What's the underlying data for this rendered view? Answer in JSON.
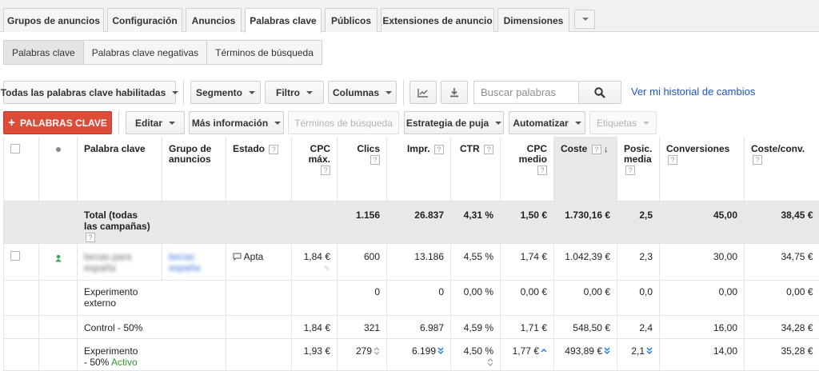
{
  "tabs": [
    {
      "label": "Grupos de anuncios",
      "active": false
    },
    {
      "label": "Configuración",
      "active": false
    },
    {
      "label": "Anuncios",
      "active": false
    },
    {
      "label": "Palabras clave",
      "active": true
    },
    {
      "label": "Públicos",
      "active": false
    },
    {
      "label": "Extensiones de anuncio",
      "active": false
    },
    {
      "label": "Dimensiones",
      "active": false
    }
  ],
  "subtabs": [
    {
      "label": "Palabras clave",
      "active": true
    },
    {
      "label": "Palabras clave negativas",
      "active": false
    },
    {
      "label": "Términos de búsqueda",
      "active": false
    }
  ],
  "toolbar": {
    "filter_all": "Todas las palabras clave habilitadas",
    "segment": "Segmento",
    "filter": "Filtro",
    "columns": "Columnas",
    "search_placeholder": "Buscar palabras",
    "history_link": "Ver mi historial de cambios"
  },
  "actions": {
    "add_keywords": "PALABRAS CLAVE",
    "edit": "Editar",
    "more_info": "Más información",
    "search_terms": "Términos de búsqueda",
    "bid_strategy": "Estrategia de puja",
    "automate": "Automatizar",
    "labels": "Etiquetas"
  },
  "table": {
    "headers": {
      "keyword": "Palabra clave",
      "ad_group": "Grupo de anuncios",
      "status": "Estado",
      "max_cpc": "CPC máx.",
      "clicks": "Clics",
      "impr": "Impr.",
      "ctr": "CTR",
      "avg_cpc": "CPC medio",
      "cost": "Coste",
      "avg_pos": "Posic. media",
      "conversions": "Conversiones",
      "cost_conv": "Coste/conv."
    },
    "help_mark": "?",
    "total": {
      "label": "Total (todas las campañas)",
      "clicks": "1.156",
      "impr": "26.837",
      "ctr": "4,31 %",
      "avg_cpc": "1,50 €",
      "cost": "1.730,16 €",
      "avg_pos": "2,5",
      "conversions": "45,00",
      "cost_conv": "38,45 €"
    },
    "rows": [
      {
        "keyword": "becas para españa",
        "ad_group": "becas españa",
        "status": "Apta",
        "max_cpc": "1,84 €",
        "clicks": "600",
        "impr": "13.186",
        "ctr": "4,55 %",
        "avg_cpc": "1,74 €",
        "cost": "1.042,39 €",
        "avg_pos": "2,3",
        "conversions": "30,00",
        "cost_conv": "34,75 €"
      },
      {
        "keyword": "Experimento externo",
        "max_cpc": "",
        "clicks": "0",
        "impr": "0",
        "ctr": "0,00 %",
        "avg_cpc": "0,00 €",
        "cost": "0,00 €",
        "avg_pos": "0,0",
        "conversions": "0,00",
        "cost_conv": "0,00 €"
      },
      {
        "keyword": "Control - 50%",
        "max_cpc": "1,84 €",
        "clicks": "321",
        "impr": "6.987",
        "ctr": "4,59 %",
        "avg_cpc": "1,71 €",
        "cost": "548,50 €",
        "avg_pos": "2,4",
        "conversions": "16,00",
        "cost_conv": "34,28 €"
      },
      {
        "keyword": "Experimento - 50%",
        "active_label": "Activo",
        "max_cpc": "1,93 €",
        "clicks": "279",
        "impr": "6.199",
        "ctr": "4,50 %",
        "avg_cpc": "1,77 €",
        "cost": "493,89 €",
        "avg_pos": "2,1",
        "conversions": "14,00",
        "cost_conv": "35,28 €"
      }
    ]
  },
  "colors": {
    "accent_red": "#dd4b39",
    "link_blue": "#1a55c0",
    "active_green": "#2d9b2d"
  }
}
